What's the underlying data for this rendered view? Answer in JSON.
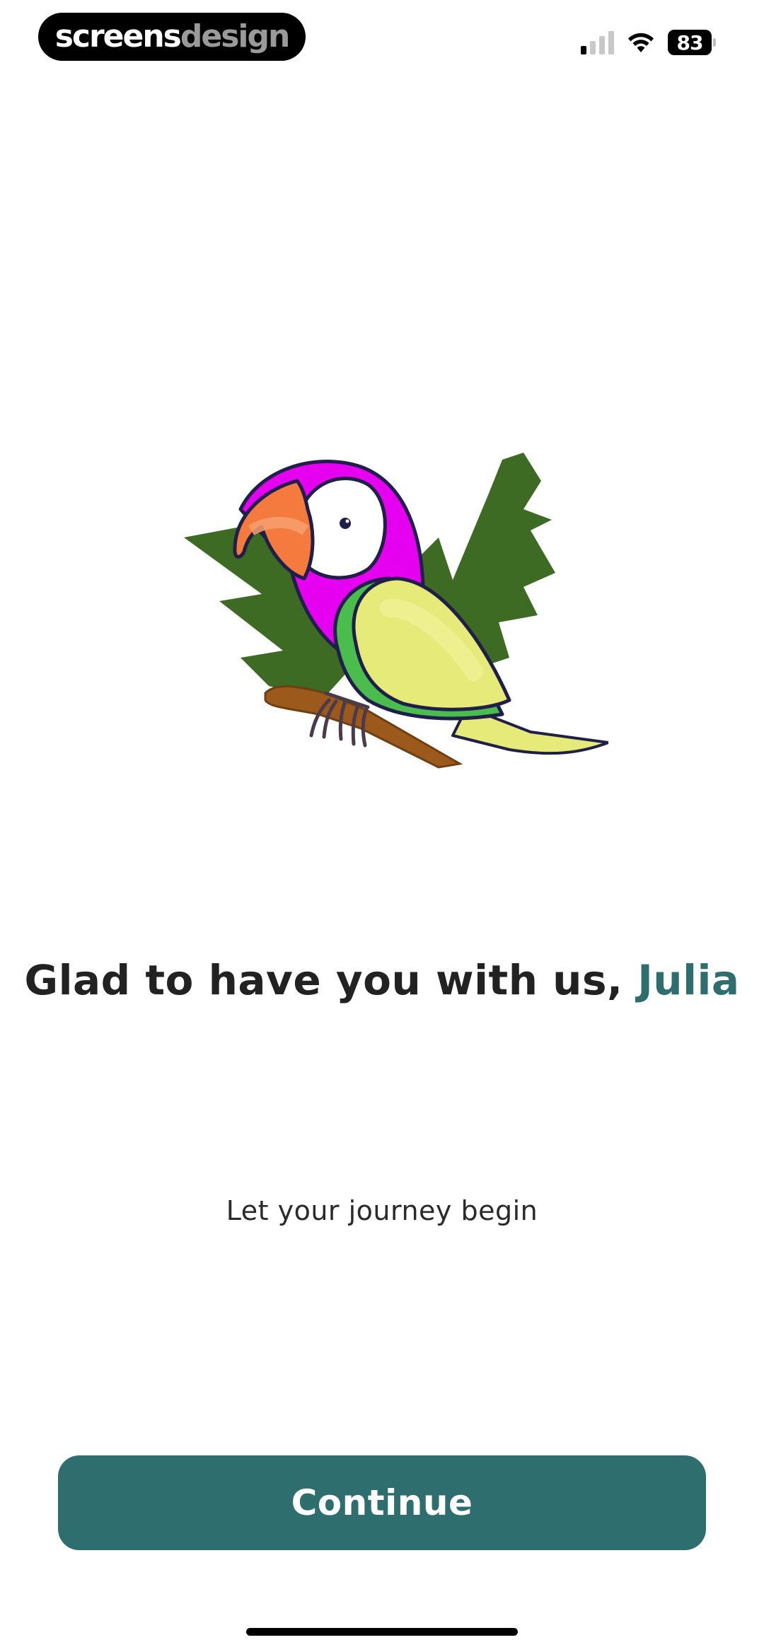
{
  "watermark": {
    "part1": "screens",
    "part2": "design"
  },
  "status_bar": {
    "battery_level": "83",
    "signal_bars_active": 1,
    "signal_bars_total": 4
  },
  "illustration": {
    "icon": "parrot-illustration",
    "colors": {
      "leaves": "#3e6b24",
      "head": "#e600f0",
      "beak": "#f47a3d",
      "wing": "#e6ea78",
      "body": "#4bbd4e",
      "branch": "#9b5a1c",
      "outline": "#1f1f4a"
    }
  },
  "greeting": {
    "prefix": "Glad to have you with us, ",
    "name": "Julia",
    "accent_color": "#2e6e6f"
  },
  "subtitle": "Let your journey begin",
  "continue_button": {
    "label": "Continue",
    "color": "#2e6e6f"
  }
}
